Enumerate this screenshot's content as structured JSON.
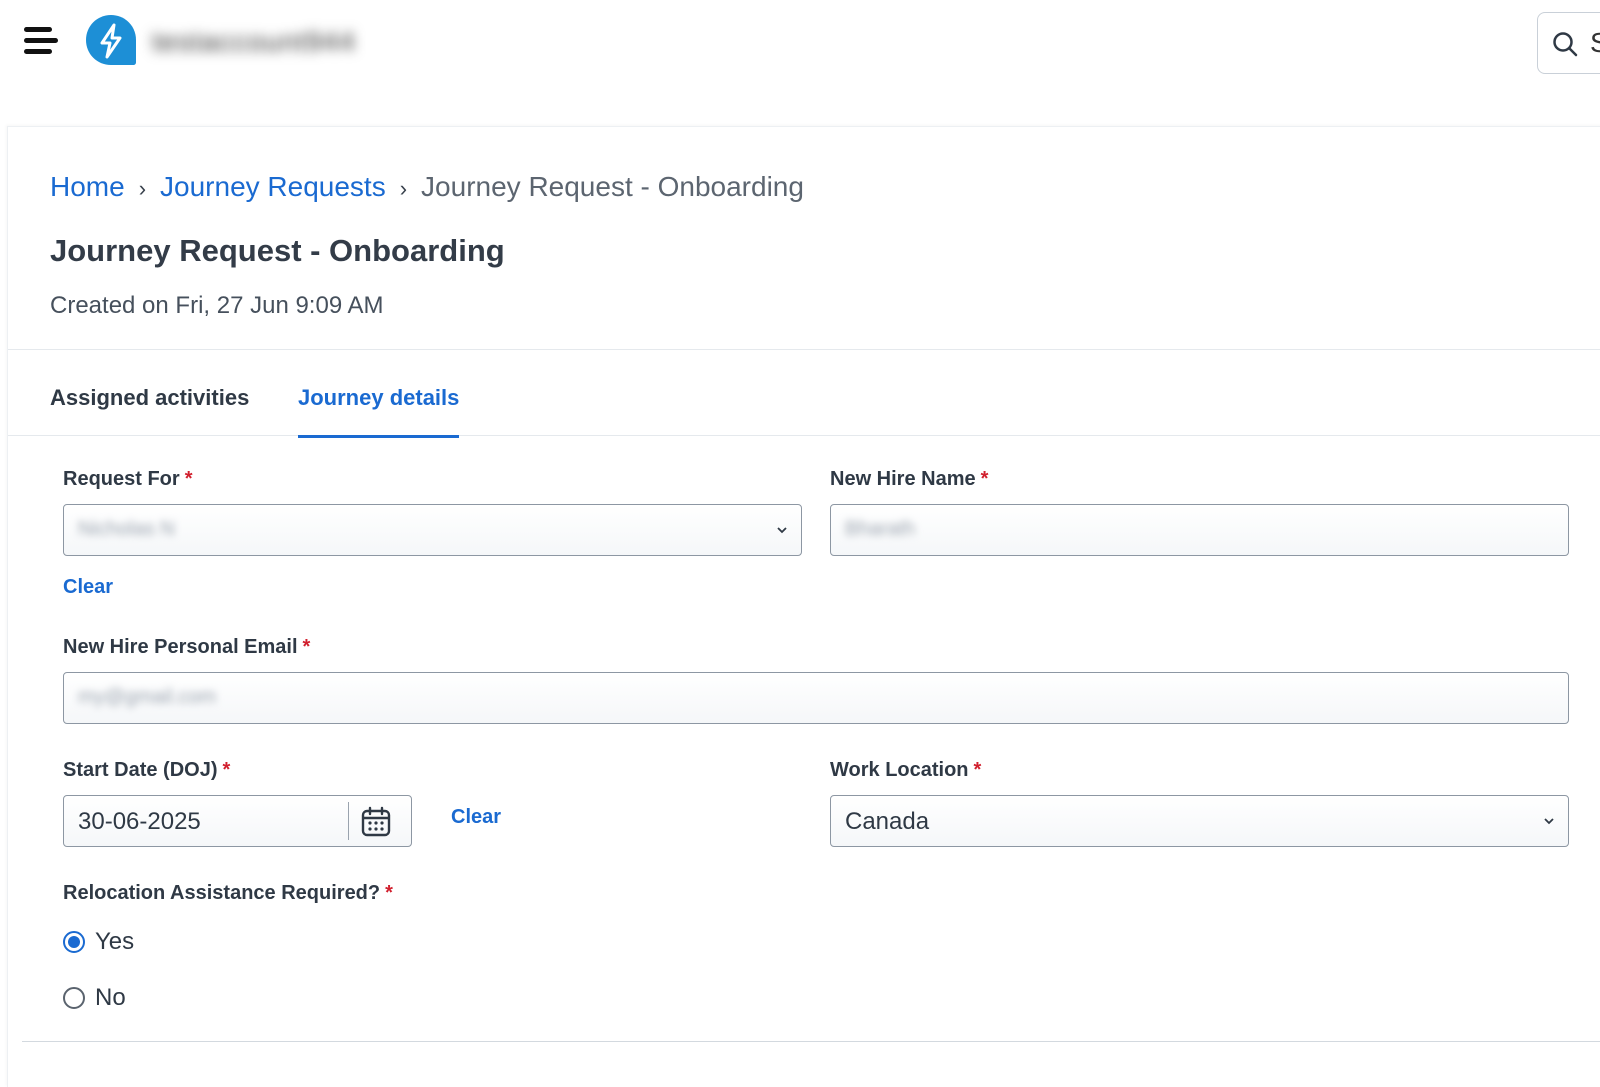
{
  "header": {
    "account_name": "testaccount944",
    "search_placeholder": "S"
  },
  "breadcrumb": {
    "home": "Home",
    "journey_requests": "Journey Requests",
    "current": "Journey Request - Onboarding",
    "separator": "›"
  },
  "page": {
    "title": "Journey Request - Onboarding",
    "created": "Created on Fri, 27 Jun 9:09 AM"
  },
  "tabs": {
    "assigned": "Assigned activities",
    "details": "Journey details",
    "active": "details"
  },
  "form": {
    "request_for": {
      "label": "Request For",
      "value": "Nicholas N",
      "clear": "Clear"
    },
    "new_hire_name": {
      "label": "New Hire Name",
      "value": "Bharath"
    },
    "email": {
      "label": "New Hire Personal Email",
      "value": "my@gmail.com"
    },
    "start_date": {
      "label": "Start Date (DOJ)",
      "value": "30-06-2025",
      "clear": "Clear"
    },
    "work_location": {
      "label": "Work Location",
      "value": "Canada"
    },
    "relocation": {
      "label": "Relocation Assistance Required?",
      "options": [
        {
          "label": "Yes",
          "selected": true
        },
        {
          "label": "No",
          "selected": false
        }
      ]
    },
    "required_marker": "*"
  },
  "colors": {
    "accent": "#1a6ad1",
    "required": "#d1202e",
    "logo": "#1d8fd6"
  },
  "icons": [
    "menu-icon",
    "lightning-logo-icon",
    "search-icon",
    "chevron-right-icon",
    "chevron-down-icon",
    "calendar-icon"
  ]
}
